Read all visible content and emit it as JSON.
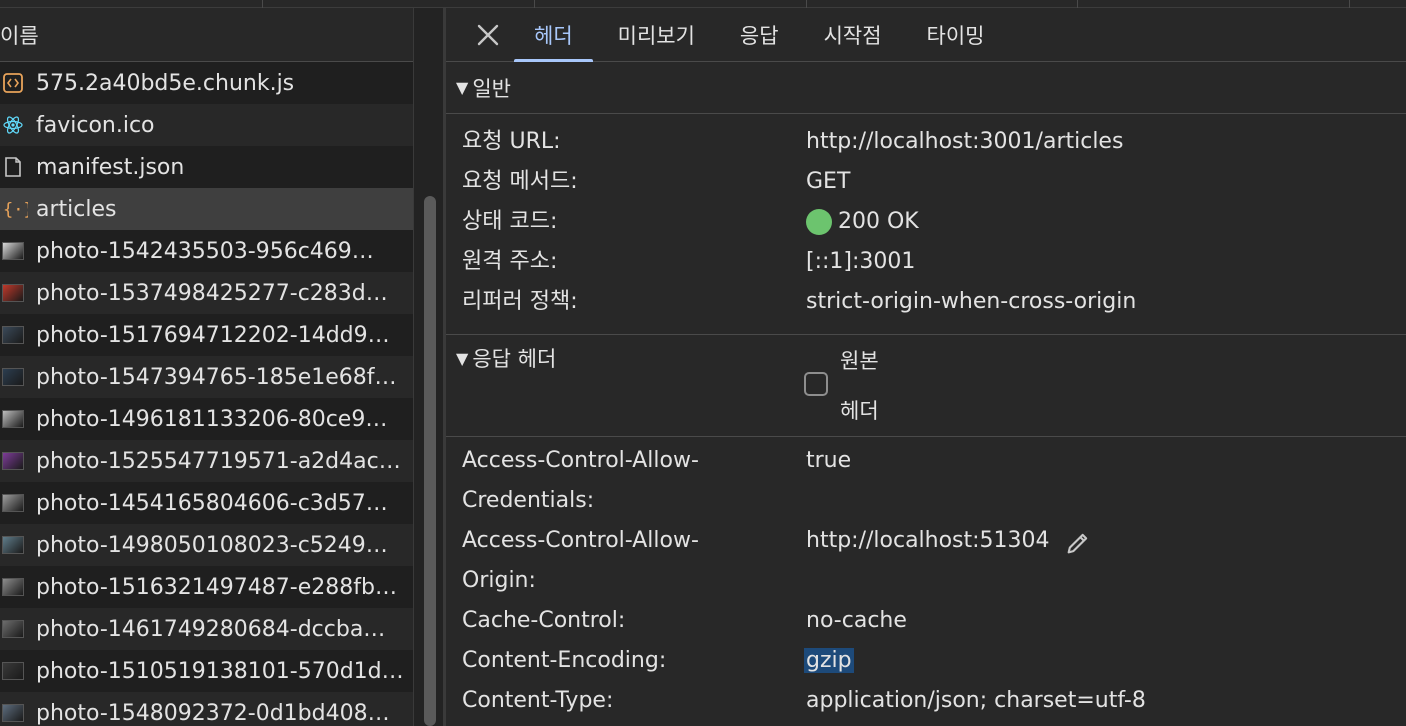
{
  "left_panel": {
    "header": "이름",
    "requests": [
      {
        "name": "575.2a40bd5e.chunk.js",
        "icon": "script-icon",
        "kind": "script"
      },
      {
        "name": "favicon.ico",
        "icon": "react-icon",
        "kind": "react"
      },
      {
        "name": "manifest.json",
        "icon": "document-icon",
        "kind": "doc"
      },
      {
        "name": "articles",
        "icon": "braces-icon",
        "kind": "fetch",
        "selected": true
      },
      {
        "name": "photo-1542435503-956c469…",
        "icon": "image-thumbnail-icon",
        "kind": "img",
        "thumb": "#d8d8d8"
      },
      {
        "name": "photo-1537498425277-c283d…",
        "icon": "image-thumbnail-icon",
        "kind": "img",
        "thumb": "#c0392b"
      },
      {
        "name": "photo-1517694712202-14dd9…",
        "icon": "image-thumbnail-icon",
        "kind": "img",
        "thumb": "#3b4a5a"
      },
      {
        "name": "photo-1547394765-185e1e68f…",
        "icon": "image-thumbnail-icon",
        "kind": "img",
        "thumb": "#2c3e50"
      },
      {
        "name": "photo-1496181133206-80ce9…",
        "icon": "image-thumbnail-icon",
        "kind": "img",
        "thumb": "#bdbdbd"
      },
      {
        "name": "photo-1525547719571-a2d4ac…",
        "icon": "image-thumbnail-icon",
        "kind": "img",
        "thumb": "#7d3c98"
      },
      {
        "name": "photo-1454165804606-c3d57…",
        "icon": "image-thumbnail-icon",
        "kind": "img",
        "thumb": "#9e9e9e"
      },
      {
        "name": "photo-1498050108023-c5249…",
        "icon": "image-thumbnail-icon",
        "kind": "img",
        "thumb": "#607d8b"
      },
      {
        "name": "photo-1516321497487-e288fb…",
        "icon": "image-thumbnail-icon",
        "kind": "img",
        "thumb": "#8d8d8d"
      },
      {
        "name": "photo-1461749280684-dccba…",
        "icon": "image-thumbnail-icon",
        "kind": "img",
        "thumb": "#6d6d6d"
      },
      {
        "name": "photo-1510519138101-570d1d…",
        "icon": "image-thumbnail-icon",
        "kind": "img",
        "thumb": "#3a3a3a"
      },
      {
        "name": "photo-1548092372-0d1bd408…",
        "icon": "image-thumbnail-icon",
        "kind": "img",
        "thumb": "#5d6d7e"
      }
    ]
  },
  "tabs": {
    "close_icon": "close-icon",
    "items": [
      {
        "label": "헤더",
        "active": true
      },
      {
        "label": "미리보기"
      },
      {
        "label": "응답"
      },
      {
        "label": "시작점"
      },
      {
        "label": "타이밍"
      }
    ]
  },
  "general": {
    "title": "일반",
    "rows": [
      {
        "key": "요청 URL:",
        "value": "http://localhost:3001/articles"
      },
      {
        "key": "요청 메서드:",
        "value": "GET"
      },
      {
        "key": "상태 코드:",
        "value": "200 OK",
        "status_color": "#6cc46e"
      },
      {
        "key": "원격 주소:",
        "value": "[::1]:3001"
      },
      {
        "key": "리퍼러 정책:",
        "value": "strict-origin-when-cross-origin"
      }
    ]
  },
  "response_headers": {
    "title": "응답 헤더",
    "raw_label_line1": "원본",
    "raw_label_line2": "헤더",
    "raw_checked": false,
    "rows": [
      {
        "key1": "Access-Control-Allow-",
        "key2": "Credentials:",
        "value": "true"
      },
      {
        "key1": "Access-Control-Allow-",
        "key2": "Origin:",
        "value": "http://localhost:51304",
        "editable": true
      },
      {
        "key1": "Cache-Control:",
        "key2": "",
        "value": "no-cache"
      },
      {
        "key1": "Content-Encoding:",
        "key2": "",
        "value": "gzip",
        "highlighted": true
      },
      {
        "key1": "Content-Type:",
        "key2": "",
        "value": "application/json; charset=utf-8"
      }
    ]
  },
  "colors": {
    "accent": "#a8c7fa",
    "highlight": "#1d4a7a",
    "status_ok": "#6cc46e"
  }
}
